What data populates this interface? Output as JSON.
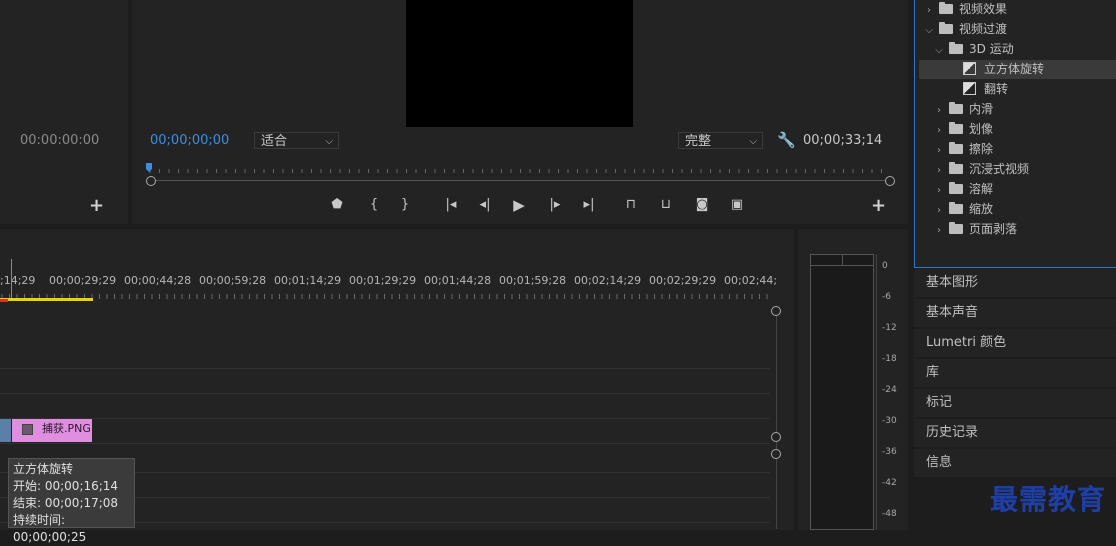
{
  "source": {
    "timecode": "00:00:00:00"
  },
  "program": {
    "timecode": "00;00;00;00",
    "fit_dropdown": "适合",
    "quality_dropdown": "完整",
    "duration": "00;00;33;14"
  },
  "effects": {
    "items": [
      {
        "label": "视频效果",
        "level": 0,
        "expanded": false,
        "type": "folder"
      },
      {
        "label": "视频过渡",
        "level": 0,
        "expanded": true,
        "type": "folder"
      },
      {
        "label": "3D 运动",
        "level": 1,
        "expanded": true,
        "type": "folder"
      },
      {
        "label": "立方体旋转",
        "level": 2,
        "type": "effect",
        "selected": true
      },
      {
        "label": "翻转",
        "level": 2,
        "type": "effect"
      },
      {
        "label": "内滑",
        "level": 1,
        "expanded": false,
        "type": "folder"
      },
      {
        "label": "划像",
        "level": 1,
        "expanded": false,
        "type": "folder"
      },
      {
        "label": "擦除",
        "level": 1,
        "expanded": false,
        "type": "folder"
      },
      {
        "label": "沉浸式视频",
        "level": 1,
        "expanded": false,
        "type": "folder"
      },
      {
        "label": "溶解",
        "level": 1,
        "expanded": false,
        "type": "folder"
      },
      {
        "label": "缩放",
        "level": 1,
        "expanded": false,
        "type": "folder"
      },
      {
        "label": "页面剥落",
        "level": 1,
        "expanded": false,
        "type": "folder"
      }
    ]
  },
  "side_panels": [
    "基本图形",
    "基本声音",
    "Lumetri 颜色",
    "库",
    "标记",
    "历史记录",
    "信息"
  ],
  "timeline": {
    "ruler_labels": [
      ";14;29",
      "00;00;29;29",
      "00;00;44;28",
      "00;00;59;28",
      "00;01;14;29",
      "00;01;29;29",
      "00;01;44;28",
      "00;01;59;28",
      "00;02;14;29",
      "00;02;29;29",
      "00;02;44;"
    ],
    "clip_name": "捕获.PNG",
    "tooltip": {
      "title": "立方体旋转",
      "start": "开始: 00;00;16;14",
      "end": "结束: 00;00;17;08",
      "duration": "持续时间: 00;00;00;25"
    }
  },
  "meter": {
    "db_labels": [
      "0",
      "-6",
      "-12",
      "-18",
      "-24",
      "-30",
      "-36",
      "-42",
      "-48"
    ]
  },
  "watermark": "最需教育"
}
